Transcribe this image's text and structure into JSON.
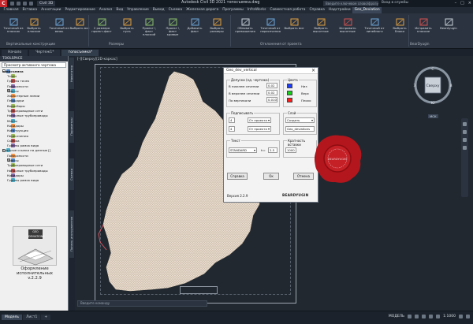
{
  "app": {
    "workspace": "Civil 3D",
    "title": "Autodesk Civil 3D 2021   топосъемка.dwg",
    "search_placeholder": "Введите ключевое слово/фразу",
    "user": "Вход в службы"
  },
  "menu_tabs": [
    "Главная",
    "Вставка",
    "Аннотации",
    "Редактирование",
    "Анализ",
    "Вид",
    "Управление",
    "Вывод",
    "Съемка",
    "Железная дорога",
    "Программы",
    "InfraWorks",
    "Совместная работа",
    "Справка",
    "Надстройки",
    "Geo_Deviation"
  ],
  "ribbon": {
    "buttons": [
      {
        "label": "Точечный из плоских"
      },
      {
        "label": "Выбрать плоские"
      },
      {
        "label": "Точечный из межь"
      },
      {
        "label": "Выбрать все"
      },
      {
        "label": "2 размера проект-факт"
      },
      {
        "label": "Выбрать нуль"
      },
      {
        "label": "Проект \\ факт плоский"
      },
      {
        "label": "Проект \\ факт кривые"
      },
      {
        "label": "Добавить факт"
      },
      {
        "label": "Выбрать размеры"
      },
      {
        "label": "Обновить превышения"
      },
      {
        "label": "Точечный от пересечения"
      },
      {
        "label": "Выбрать все"
      },
      {
        "label": "Выбрать высотные"
      },
      {
        "label": "Исправить высотные"
      },
      {
        "label": "Точечный от линейного"
      },
      {
        "label": "Выбрать блоки"
      },
      {
        "label": "Исправить плоские"
      },
      {
        "label": "Beardyugin"
      }
    ],
    "groups": [
      "Вертикальные конструкции",
      "Размеры",
      "Отклонения от проекта",
      "BearDyugin"
    ]
  },
  "doc_tabs": [
    "Начало",
    "Чертеж1*",
    "топосъемка*"
  ],
  "toolspace": {
    "header": "TOOLSPACE",
    "combo": "Просмотр активного чертежа",
    "tree": [
      {
        "label": "топосъемка",
        "level": 0,
        "bold": true,
        "exp": "-"
      },
      {
        "label": "Точки",
        "level": 1
      },
      {
        "label": "Группы точек",
        "level": 1
      },
      {
        "label": "Поверхности",
        "level": 1
      },
      {
        "label": "Трассы",
        "level": 1,
        "exp": "+"
      },
      {
        "label": "Характерные линии",
        "level": 1
      },
      {
        "label": "Площадки",
        "level": 1
      },
      {
        "label": "Водосборы",
        "level": 1
      },
      {
        "label": "Трубопроводные сети",
        "level": 1
      },
      {
        "label": "Напорные трубопроводы",
        "level": 1
      },
      {
        "label": "Мосты",
        "level": 1
      },
      {
        "label": "Коридоры",
        "level": 1
      },
      {
        "label": "Конструкция",
        "level": 1
      },
      {
        "label": "Пересечения",
        "level": 1
      },
      {
        "label": "Съемка",
        "level": 1
      },
      {
        "label": "Группы рамок вида",
        "level": 1
      },
      {
        "label": "Быстрые ссылки на данные []",
        "level": 0,
        "exp": "-"
      },
      {
        "label": "Поверхности",
        "level": 1
      },
      {
        "label": "Трассы",
        "level": 1,
        "exp": "+"
      },
      {
        "label": "Трубопроводные сети",
        "level": 1
      },
      {
        "label": "Напорные трубопроводы",
        "level": 1
      },
      {
        "label": "Коридоры",
        "level": 1
      },
      {
        "label": "Группы рамок вида",
        "level": 1
      }
    ],
    "side_tabs": [
      "Навигатор",
      "Параметры",
      "Съемка",
      "Панель инструментов"
    ],
    "plugin_badge": "GEO DEVIATIONS",
    "plugin_title": "Оформление исполнительных",
    "plugin_version": "v.2.2.9"
  },
  "viewport_label": "[-][Сверху][2D-каркас]",
  "dialog": {
    "title": "Geo_dev_vertical",
    "close": "×",
    "tolerance_legend": "Допуски (ед. чертежа)",
    "tol_rows": [
      {
        "label": "В нижнем сечении",
        "value": "0.02"
      },
      {
        "label": "В верхнем сечении",
        "value": "0.02"
      },
      {
        "label": "По вертикали",
        "value": "0.010"
      }
    ],
    "colors_legend": "Цвета",
    "colors": [
      {
        "label": "Низ",
        "hex": "#1a3cff"
      },
      {
        "label": "Верх",
        "hex": "#17d11a"
      },
      {
        "label": "Плохо",
        "hex": "#ff1a1a"
      }
    ],
    "sign_legend": "Подписывать",
    "sign_rows": [
      {
        "value": "4",
        "option": "От проекта"
      },
      {
        "value": "4",
        "option": "От проекта"
      }
    ],
    "layer_legend": "Слой",
    "layer_option": "Создать",
    "layer_name": "Geo_deviations",
    "text_legend": "Текст",
    "text_style": "STANDARD",
    "text_height_label": "h=",
    "text_height": "2.5",
    "scale_legend": "Кратность вставки",
    "scale_value": "1000",
    "buttons": [
      "Справка",
      "Ок",
      "Отмена"
    ],
    "version": "Версия 2.2.9",
    "brand": "BEARDYUGIN"
  },
  "seal": {
    "text": "BEARDYUGIN"
  },
  "navcube": {
    "face": "Сверху",
    "n": "С",
    "s": "Ю",
    "w": "З",
    "e": "В",
    "wcs": "МСК"
  },
  "cmdline_placeholder": "Введите команду",
  "status": {
    "layout_tabs": [
      "Модель",
      "Лист1",
      "+"
    ],
    "model_label": "МОДЕЛЬ",
    "scale": "1:1000"
  },
  "colors": {
    "accent": "#c8262d",
    "canvas": "#212830",
    "survey": "#efe3d6"
  }
}
